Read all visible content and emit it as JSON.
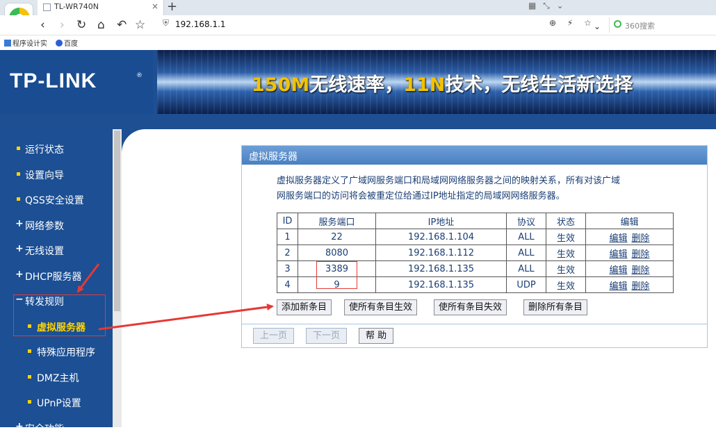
{
  "browser": {
    "tab_title": "TL-WR740N",
    "tab_close": "×",
    "new_tab": "+",
    "tab_tools": "▦ ⤡ ⌄",
    "url": "192.168.1.1",
    "url_actions": "⊕ ⚡ ☆",
    "search_placeholder": "360搜索",
    "bookmarks": [
      "程序设计实",
      "百度"
    ]
  },
  "banner": {
    "logo": "TP-LINK",
    "logo_mark": "®",
    "slogan_hl1": "150M",
    "slogan_t1": "无线速率，",
    "slogan_hl2": "11N",
    "slogan_t2": "技术，无线生活新选择"
  },
  "sidebar": {
    "items": [
      {
        "label": "运行状态"
      },
      {
        "label": "设置向导"
      },
      {
        "label": "QSS安全设置"
      },
      {
        "label": "网络参数"
      },
      {
        "label": "无线设置"
      },
      {
        "label": "DHCP服务器"
      },
      {
        "label": "转发规则"
      },
      {
        "label": "虚拟服务器"
      },
      {
        "label": "特殊应用程序"
      },
      {
        "label": "DMZ主机"
      },
      {
        "label": "UPnP设置"
      },
      {
        "label": "安全功能"
      }
    ]
  },
  "panel": {
    "title": "虚拟服务器",
    "desc_line1": "虚拟服务器定义了广域网服务端口和局域网网络服务器之间的映射关系，所有对该广域",
    "desc_line2": "网服务端口的访问将会被重定位给通过IP地址指定的局域网网络服务器。",
    "columns": [
      "ID",
      "服务端口",
      "IP地址",
      "协议",
      "状态",
      "编辑"
    ],
    "rows": [
      {
        "id": "1",
        "port": "22",
        "ip": "192.168.1.104",
        "proto": "ALL",
        "status": "生效",
        "edit": "编辑",
        "del": "删除"
      },
      {
        "id": "2",
        "port": "8080",
        "ip": "192.168.1.112",
        "proto": "ALL",
        "status": "生效",
        "edit": "编辑",
        "del": "删除"
      },
      {
        "id": "3",
        "port": "3389",
        "ip": "192.168.1.135",
        "proto": "ALL",
        "status": "生效",
        "edit": "编辑",
        "del": "删除"
      },
      {
        "id": "4",
        "port": "9",
        "ip": "192.168.1.135",
        "proto": "UDP",
        "status": "生效",
        "edit": "编辑",
        "del": "删除"
      }
    ],
    "buttons": {
      "add": "添加新条目",
      "enable_all": "使所有条目生效",
      "disable_all": "使所有条目失效",
      "delete_all": "删除所有条目"
    },
    "pager": {
      "prev": "上一页",
      "next": "下一页",
      "help": "帮 助"
    }
  },
  "colors": {
    "router_blue": "#1c4f93",
    "highlight_yellow": "#ffd400",
    "annotation_red": "#e53935"
  }
}
